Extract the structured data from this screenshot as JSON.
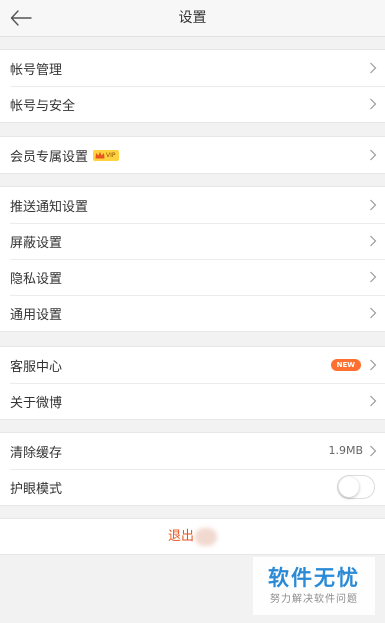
{
  "header": {
    "title": "设置"
  },
  "sections": [
    {
      "items": [
        {
          "label": "帐号管理"
        },
        {
          "label": "帐号与安全"
        }
      ]
    },
    {
      "items": [
        {
          "label": "会员专属设置",
          "badge": "VIP"
        }
      ]
    },
    {
      "items": [
        {
          "label": "推送通知设置"
        },
        {
          "label": "屏蔽设置"
        },
        {
          "label": "隐私设置"
        },
        {
          "label": "通用设置"
        }
      ]
    },
    {
      "items": [
        {
          "label": "客服中心",
          "badge": "NEW"
        },
        {
          "label": "关于微博"
        }
      ]
    },
    {
      "items": [
        {
          "label": "清除缓存",
          "value": "1.9MB"
        },
        {
          "label": "护眼模式",
          "toggle": false
        }
      ]
    }
  ],
  "logout": {
    "label": "退出"
  },
  "watermark": {
    "title": "软件无忧",
    "subtitle": "努力解决软件问题"
  },
  "icons": {
    "back": "back-arrow-icon",
    "chevron": "chevron-right-icon",
    "crown": "crown-icon"
  },
  "colors": {
    "accent": "#e8541e",
    "new_badge": "#ff7030",
    "vip_badge": "#ffd240",
    "watermark": "#2a8ad6"
  }
}
